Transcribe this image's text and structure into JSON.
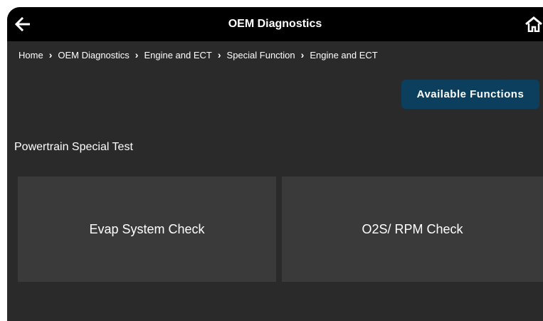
{
  "header": {
    "title": "OEM Diagnostics",
    "back_icon": "arrow-left-icon",
    "home_icon": "home-icon"
  },
  "breadcrumb": [
    "Home",
    "OEM Diagnostics",
    "Engine and ECT",
    "Special Function",
    "Engine and ECT"
  ],
  "actions": {
    "available_functions_label": "Available Functions"
  },
  "section": {
    "title": "Powertrain Special Test",
    "tiles": [
      {
        "label": "Evap System Check"
      },
      {
        "label": "O2S/ RPM Check"
      }
    ]
  },
  "colors": {
    "background": "#2a2a2a",
    "topbar": "#000000",
    "tile": "#3a3a3a",
    "accent_button": "#0c3f5e",
    "text": "#ffffff"
  }
}
